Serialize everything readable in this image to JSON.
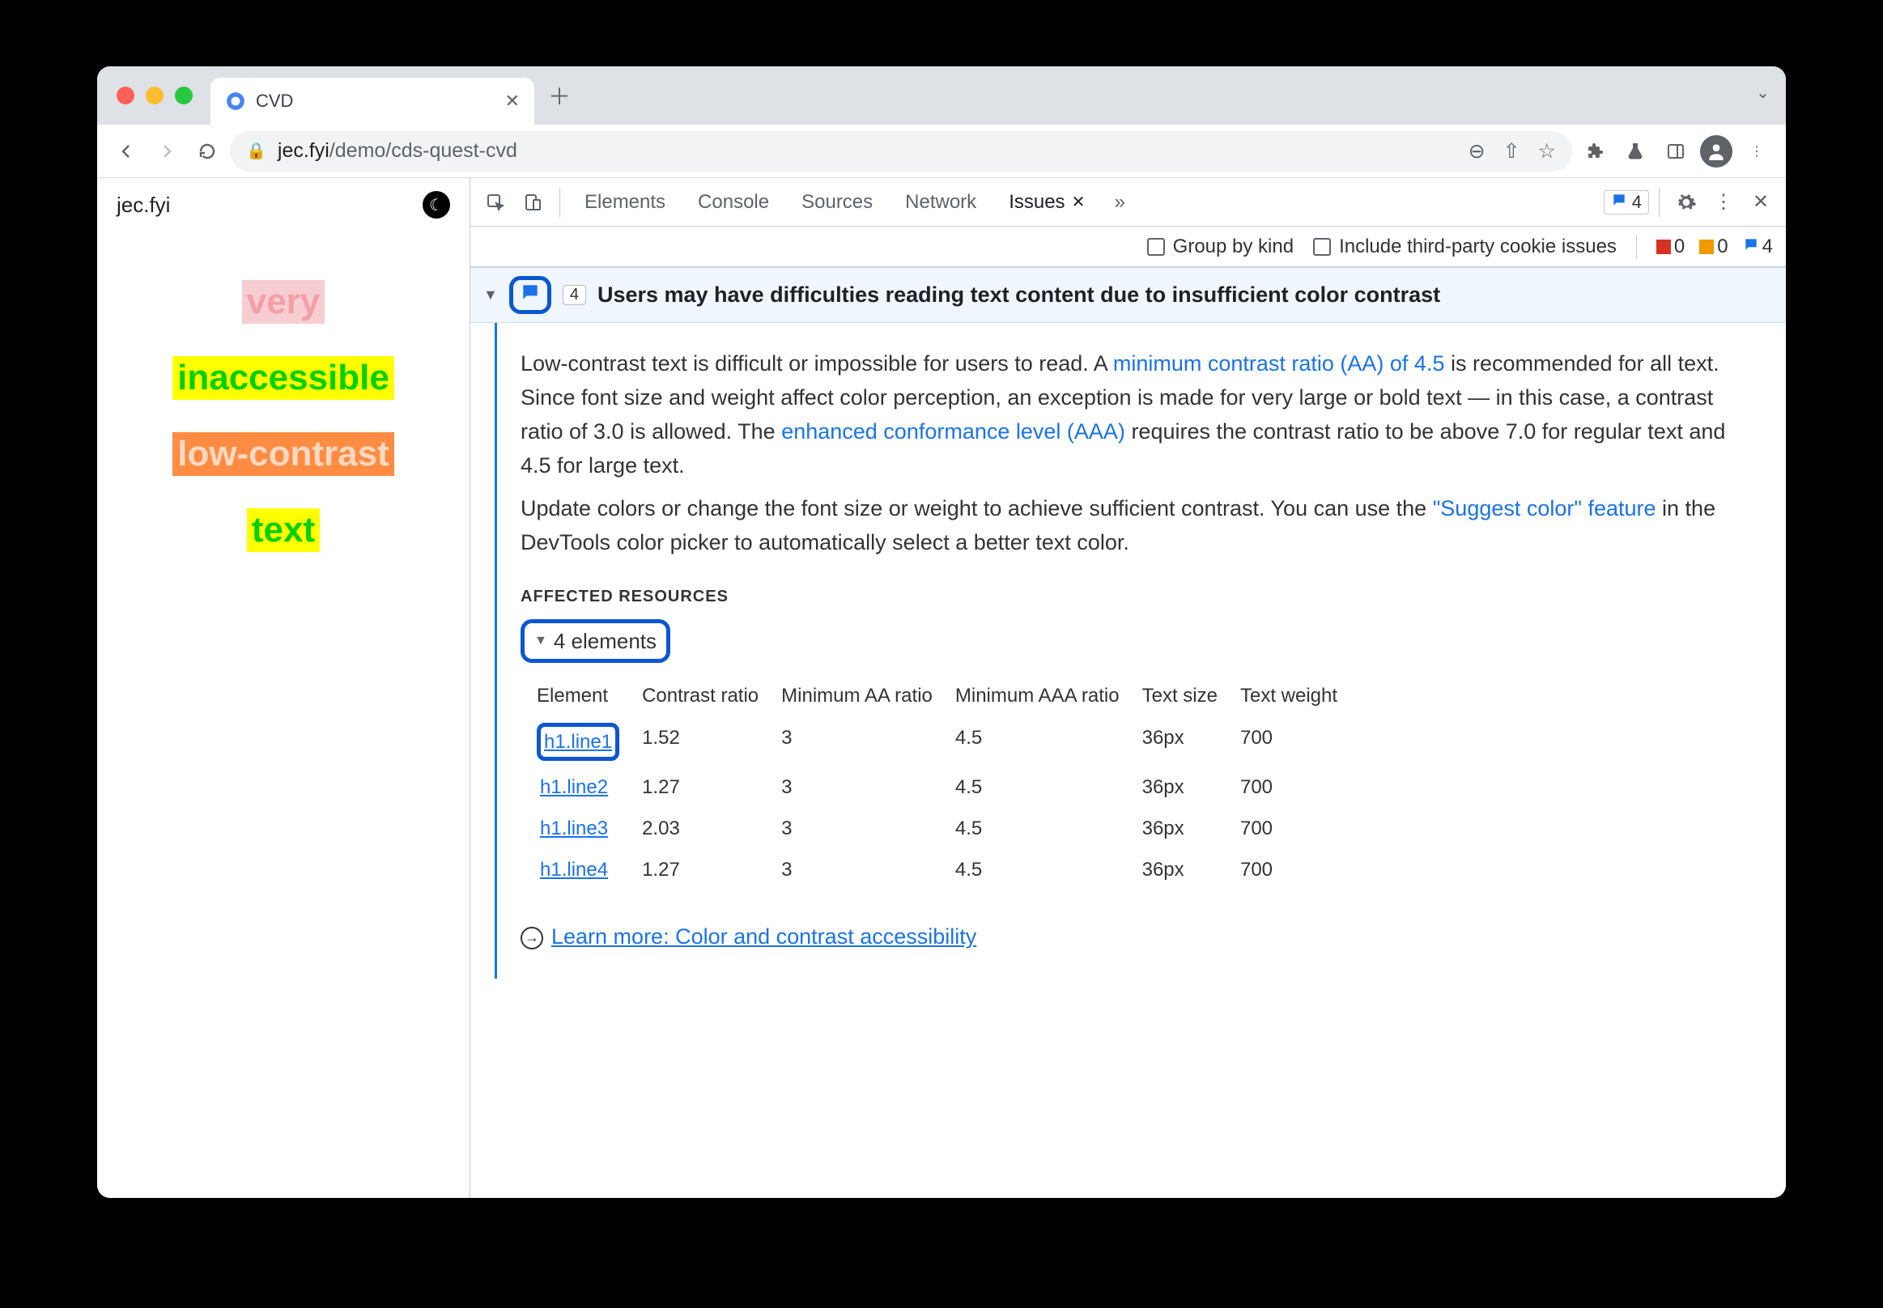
{
  "window": {
    "tab_title": "CVD"
  },
  "omnibox": {
    "host": "jec.fyi",
    "path": "/demo/cds-quest-cvd"
  },
  "page": {
    "brand": "jec.fyi",
    "words": [
      "very",
      "inaccessible",
      "low-contrast",
      "text"
    ]
  },
  "devtools": {
    "tabs": [
      "Elements",
      "Console",
      "Sources",
      "Network",
      "Issues"
    ],
    "active_tab": "Issues",
    "message_count": "4",
    "filter": {
      "group_label": "Group by kind",
      "third_party_label": "Include third-party cookie issues",
      "errors": "0",
      "warnings": "0",
      "messages": "4"
    },
    "issue": {
      "count": "4",
      "title": "Users may have difficulties reading text content due to insufficient color contrast",
      "para1_a": "Low-contrast text is difficult or impossible for users to read. A ",
      "para1_link1": "minimum contrast ratio (AA) of 4.5",
      "para1_b": " is recommended for all text. Since font size and weight affect color perception, an exception is made for very large or bold text — in this case, a contrast ratio of 3.0 is allowed. The ",
      "para1_link2": "enhanced conformance level (AAA)",
      "para1_c": " requires the contrast ratio to be above 7.0 for regular text and 4.5 for large text.",
      "para2_a": "Update colors or change the font size or weight to achieve sufficient contrast. You can use the ",
      "para2_link": "\"Suggest color\" feature",
      "para2_b": " in the DevTools color picker to automatically select a better text color.",
      "affected_heading": "AFFECTED RESOURCES",
      "affected_sub": "4 elements",
      "columns": [
        "Element",
        "Contrast ratio",
        "Minimum AA ratio",
        "Minimum AAA ratio",
        "Text size",
        "Text weight"
      ],
      "rows": [
        {
          "element": "h1.line1",
          "ratio": "1.52",
          "aa": "3",
          "aaa": "4.5",
          "size": "36px",
          "weight": "700"
        },
        {
          "element": "h1.line2",
          "ratio": "1.27",
          "aa": "3",
          "aaa": "4.5",
          "size": "36px",
          "weight": "700"
        },
        {
          "element": "h1.line3",
          "ratio": "2.03",
          "aa": "3",
          "aaa": "4.5",
          "size": "36px",
          "weight": "700"
        },
        {
          "element": "h1.line4",
          "ratio": "1.27",
          "aa": "3",
          "aaa": "4.5",
          "size": "36px",
          "weight": "700"
        }
      ],
      "learn_label": "Learn more: Color and contrast accessibility"
    }
  }
}
